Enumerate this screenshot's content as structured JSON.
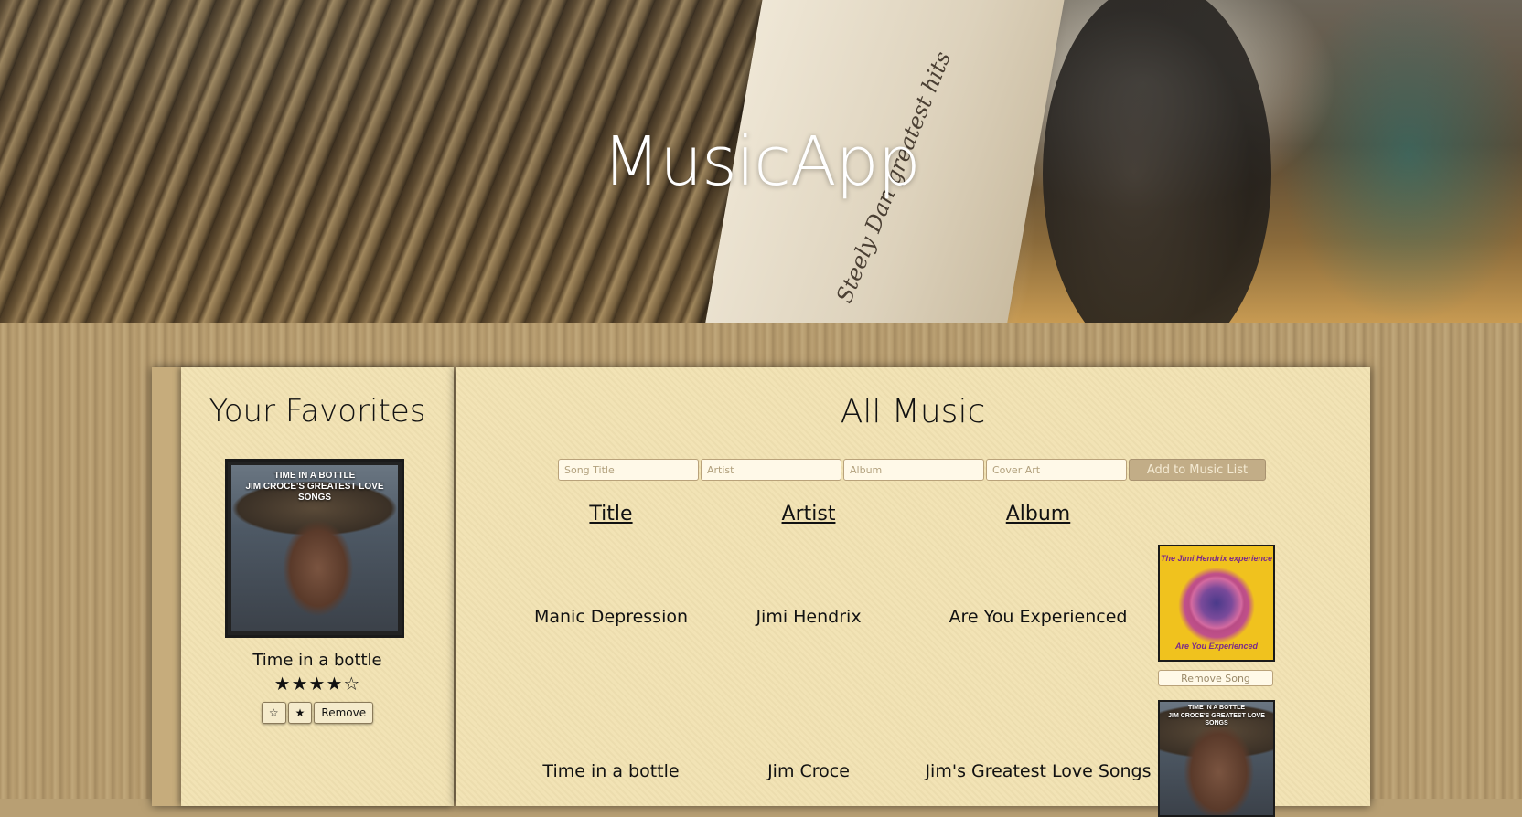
{
  "header": {
    "app_title": "MusicApp",
    "sleeve_text": "Steely Dan greatest hits"
  },
  "favorites": {
    "heading": "Your Favorites",
    "items": [
      {
        "title": "Time in a bottle",
        "cover_line1": "TIME IN A BOTTLE",
        "cover_line2": "JIM CROCE'S GREATEST LOVE SONGS",
        "rating_stars": "★★★★☆",
        "rating": 4,
        "rating_max": 5,
        "star_empty_label": "☆",
        "star_full_label": "★",
        "remove_label": "Remove"
      }
    ]
  },
  "all_music": {
    "heading": "All Music",
    "form": {
      "title_placeholder": "Song Title",
      "artist_placeholder": "Artist",
      "album_placeholder": "Album",
      "cover_placeholder": "Cover Art",
      "submit_label": "Add to Music List"
    },
    "columns": {
      "title": "Title",
      "artist": "Artist",
      "album": "Album"
    },
    "songs": [
      {
        "title": "Manic Depression",
        "artist": "Jimi Hendrix",
        "album": "Are You Experienced",
        "cover_line1": "The Jimi Hendrix experience",
        "cover_line2": "Are You Experienced",
        "remove_label": "Remove Song"
      },
      {
        "title": "Time in a bottle",
        "artist": "Jim Croce",
        "album": "Jim's Greatest Love Songs",
        "cover_line1": "TIME IN A BOTTLE",
        "cover_line2": "JIM CROCE'S GREATEST LOVE SONGS"
      }
    ]
  },
  "colors": {
    "panel": "#f2e3b5",
    "wood": "#b99f72",
    "button": "#c2ad87",
    "title_text": "#ffffff"
  }
}
